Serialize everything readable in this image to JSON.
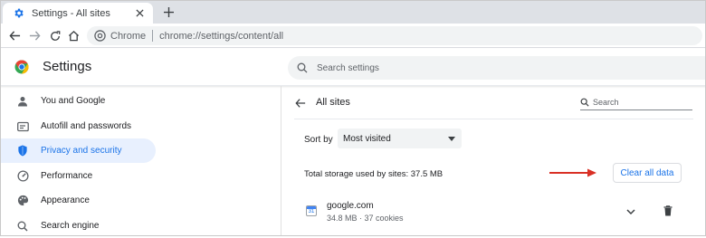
{
  "tab": {
    "title": "Settings - All sites"
  },
  "toolbar": {
    "chip": "Chrome",
    "url": "chrome://settings/content/all"
  },
  "header": {
    "title": "Settings",
    "search_placeholder": "Search settings"
  },
  "sidebar": {
    "items": [
      {
        "label": "You and Google",
        "icon": "person-icon"
      },
      {
        "label": "Autofill and passwords",
        "icon": "autofill-icon"
      },
      {
        "label": "Privacy and security",
        "icon": "shield-icon",
        "active": true
      },
      {
        "label": "Performance",
        "icon": "speedometer-icon"
      },
      {
        "label": "Appearance",
        "icon": "palette-icon"
      },
      {
        "label": "Search engine",
        "icon": "search-icon"
      }
    ]
  },
  "panel": {
    "title": "All sites",
    "search_placeholder": "Search",
    "sort_label": "Sort by",
    "sort_value": "Most visited",
    "storage_text": "Total storage used by sites: 37.5 MB",
    "clear_label": "Clear all data",
    "sites": [
      {
        "name": "google.com",
        "meta": "34.8 MB · 37 cookies",
        "favicon_text": "31"
      }
    ]
  },
  "colors": {
    "accent": "#1a73e8",
    "active_bg": "#e8f0fe",
    "annotation_arrow": "#d93025"
  }
}
